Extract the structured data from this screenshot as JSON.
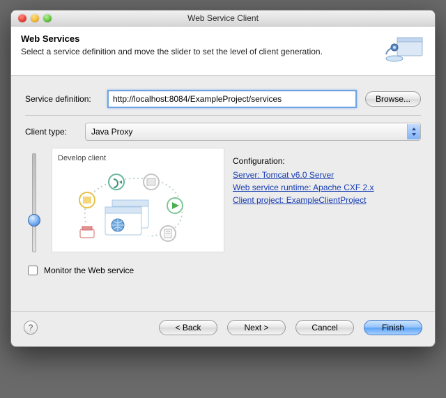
{
  "window": {
    "title": "Web Service Client"
  },
  "banner": {
    "heading": "Web Services",
    "description": "Select a service definition and move the slider to set the level of client generation."
  },
  "service_definition": {
    "label": "Service definition:",
    "value": "http://localhost:8084/ExampleProject/services",
    "browse_label": "Browse..."
  },
  "client_type": {
    "label": "Client type:",
    "value": "Java Proxy"
  },
  "slider": {
    "stage_label": "Develop client"
  },
  "configuration": {
    "heading": "Configuration:",
    "server": "Server: Tomcat v6.0 Server",
    "runtime": "Web service runtime: Apache CXF 2.x",
    "project": "Client project: ExampleClientProject"
  },
  "monitor": {
    "label": "Monitor the Web service",
    "checked": false
  },
  "buttons": {
    "back": "< Back",
    "next": "Next >",
    "cancel": "Cancel",
    "finish": "Finish"
  }
}
